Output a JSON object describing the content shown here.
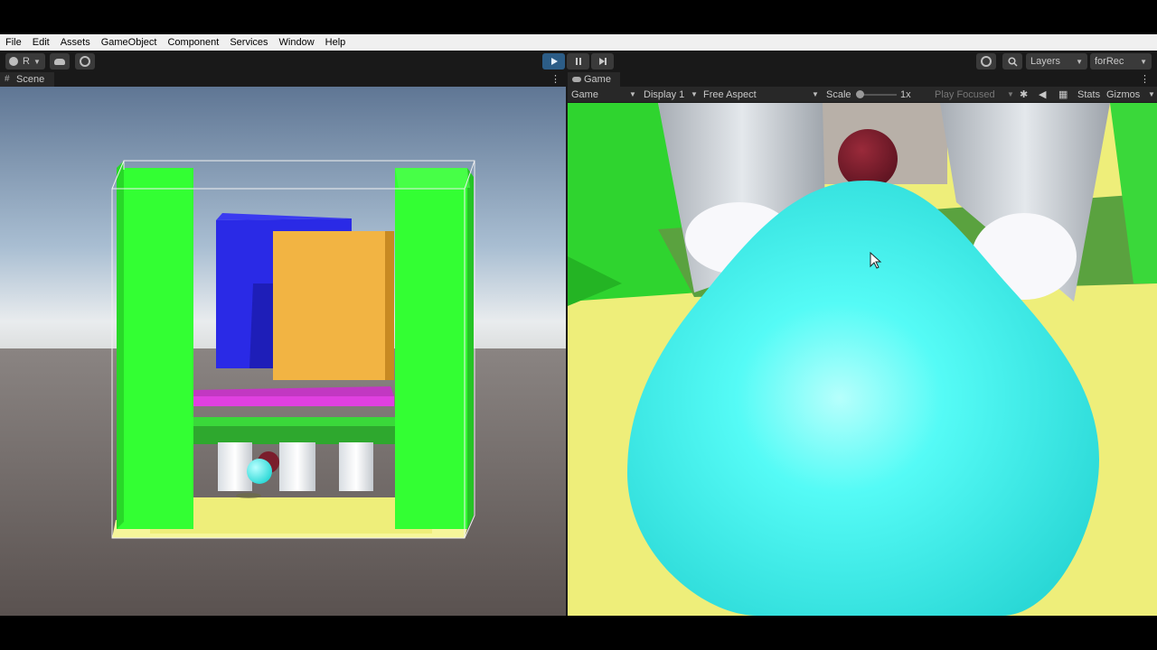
{
  "menu": [
    "File",
    "Edit",
    "Assets",
    "GameObject",
    "Component",
    "Services",
    "Window",
    "Help"
  ],
  "toolbar": {
    "account_label": "R",
    "layers_label": "Layers",
    "layout_label": "forRec"
  },
  "scene_tab": {
    "label": "Scene"
  },
  "game_tab": {
    "label": "Game"
  },
  "game_bar": {
    "mode": "Game",
    "display": "Display 1",
    "aspect": "Free Aspect",
    "scale_label": "Scale",
    "scale_value": "1x",
    "play_focused": "Play Focused",
    "stats": "Stats",
    "gizmos": "Gizmos"
  },
  "colors": {
    "editor_dark": "#191919",
    "panel": "#282828",
    "play_active": "#2c5d87",
    "green_wall": "#33ff33",
    "blue_block": "#2a2ae6",
    "orange_block": "#f2b443",
    "magenta_platform": "#e040e0",
    "cyan_ball": "#3ff5f0",
    "maroon_ball": "#7a1e2c",
    "yellow_floor": "#eeee7a"
  }
}
